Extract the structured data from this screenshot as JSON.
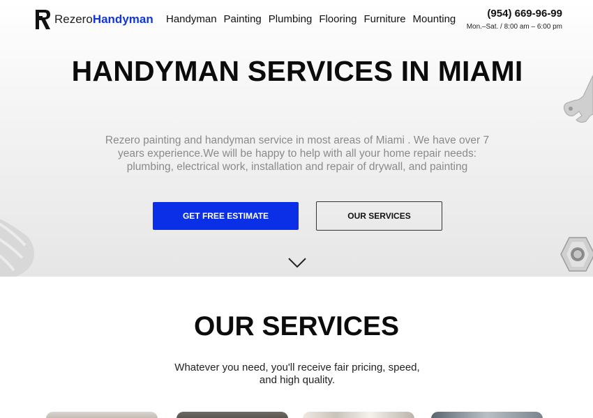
{
  "brand": {
    "name_plain": "Rezero",
    "name_accent": "Handyman",
    "accent_color": "#1137d8"
  },
  "nav": {
    "items": [
      {
        "label": "Handyman"
      },
      {
        "label": "Painting"
      },
      {
        "label": "Plumbing"
      },
      {
        "label": "Flooring"
      },
      {
        "label": "Furniture"
      },
      {
        "label": "Mounting"
      }
    ]
  },
  "contact": {
    "phone": "(954) 669-96-99",
    "hours": "Mon.–Sat. / 8:00 am – 6:00 pm"
  },
  "hero": {
    "title": "HANDYMAN SERVICES IN MIAMI",
    "description": "Rezero painting and handyman service in most areas of Miami . We have over 7 years experience.We will be happy to help with all your home repair needs: plumbing, electrical work, installation and repair of drywall, and painting",
    "primary_button": "GET FREE ESTIMATE",
    "secondary_button": "OUR SERVICES",
    "primary_color": "#0a2fe6",
    "scroll_icon": "chevron-down-icon"
  },
  "services": {
    "title": "OUR SERVICES",
    "subtitle": "Whatever you need, you'll receive fair pricing, speed, and high quality."
  }
}
